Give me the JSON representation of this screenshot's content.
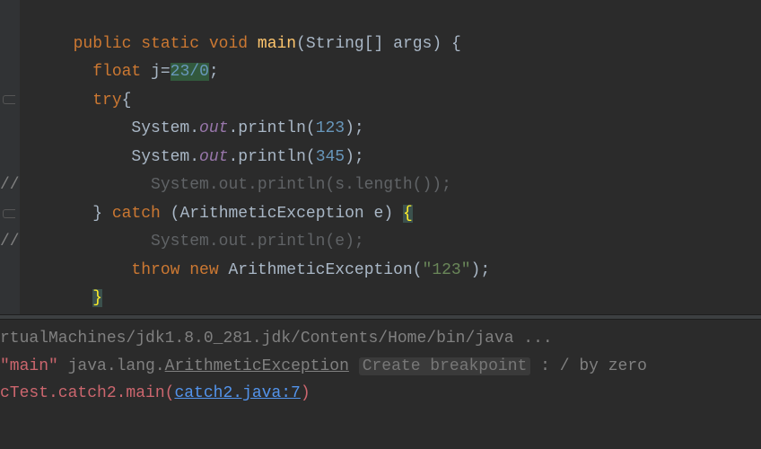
{
  "code": {
    "l1": {
      "kw1": "public",
      "kw2": "static",
      "kw3": "void",
      "method": "main",
      "type": "String",
      "brackets": "[]",
      "arg": "args",
      "brace": "{"
    },
    "l2": {
      "type": "float",
      "var": "j",
      "eq": "=",
      "n1": "23",
      "slash": "/",
      "n2": "0",
      "semi": ";"
    },
    "l3": {
      "kw": "try",
      "brace": "{"
    },
    "l4": {
      "cls": "System",
      "dot1": ".",
      "field": "out",
      "dot2": ".",
      "method": "println",
      "lp": "(",
      "num": "123",
      "rp": ")",
      "semi": ";"
    },
    "l5": {
      "cls": "System",
      "dot1": ".",
      "field": "out",
      "dot2": ".",
      "method": "println",
      "lp": "(",
      "num": "345",
      "rp": ")",
      "semi": ";"
    },
    "l6": {
      "slashes": "//",
      "text": "System.out.println(s.length());"
    },
    "l7": {
      "rbrace": "}",
      "kw": "catch",
      "lp": "(",
      "type": "ArithmeticException",
      "var": "e",
      "rp": ")",
      "lbrace": "{"
    },
    "l8": {
      "slashes": "//",
      "text": "System.out.println(e);"
    },
    "l9": {
      "kw1": "throw",
      "kw2": "new",
      "cls": "ArithmeticException",
      "lp": "(",
      "str": "\"123\"",
      "rp": ")",
      "semi": ";"
    },
    "l10": {
      "brace": "}"
    }
  },
  "console": {
    "l1": {
      "path": "rtualMachines/jdk1.8.0_281.jdk/Contents/Home/bin/java ..."
    },
    "l2": {
      "thread": "\"main\"",
      "pkg": " java.lang.",
      "ex": "ArithmeticException",
      "hint": "Create breakpoint",
      "rest": " : / by zero"
    },
    "l3": {
      "pre": "cTest.catch2.main(",
      "link": "catch2.java:7",
      "post": ")"
    }
  }
}
